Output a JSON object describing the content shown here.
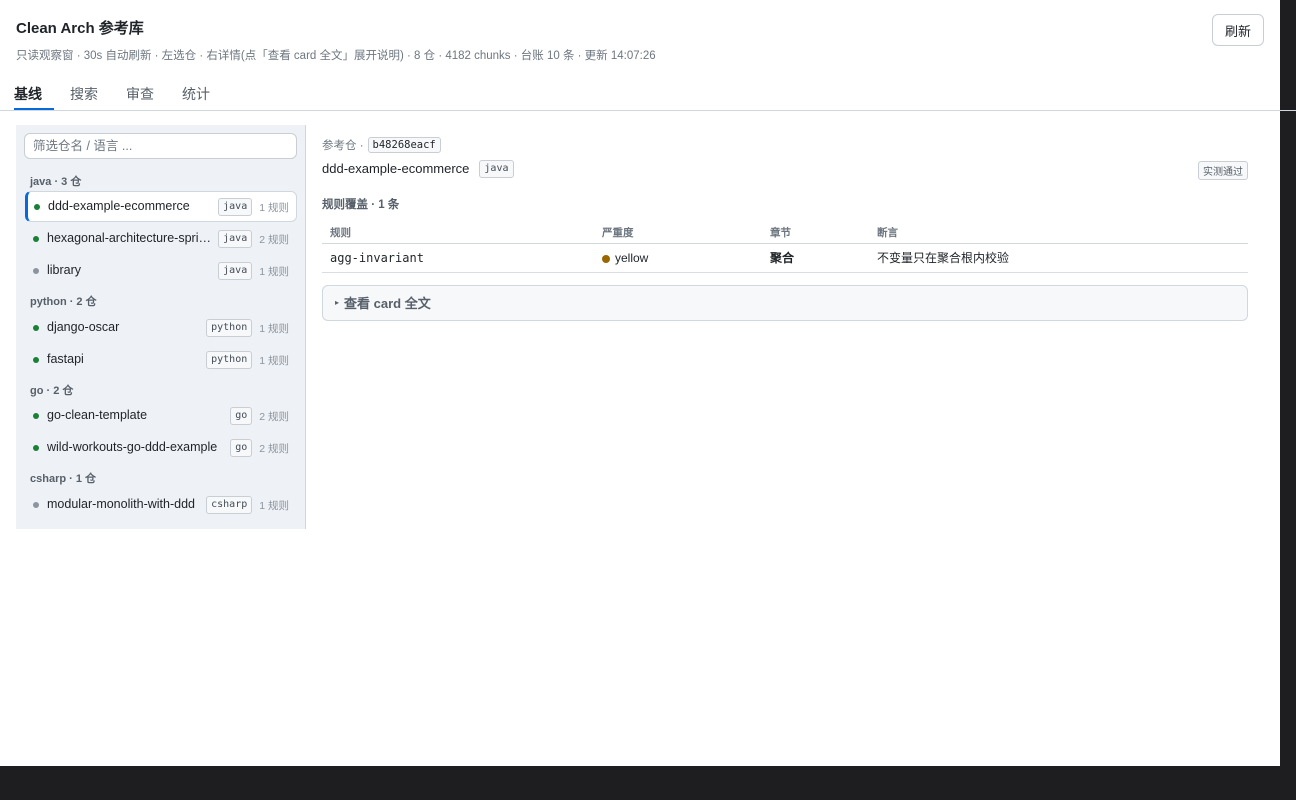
{
  "header": {
    "title": "Clean Arch 参考库",
    "subtitle": "只读观察窗 · 30s 自动刷新 · 左选仓 · 右详情(点「查看 card 全文」展开说明) · 8 仓 · 4182 chunks · 台账 10 条 · 更新 14:07:26",
    "refresh_label": "刷新"
  },
  "tabs": [
    {
      "label": "基线",
      "active": true
    },
    {
      "label": "搜索",
      "active": false
    },
    {
      "label": "审查",
      "active": false
    },
    {
      "label": "统计",
      "active": false
    }
  ],
  "sidebar": {
    "filter_placeholder": "筛选仓名 / 语言 ...",
    "groups": [
      {
        "label": "java · 3 仓",
        "repos": [
          {
            "name": "ddd-example-ecommerce",
            "lang": "java",
            "rules": "1 规则",
            "status": "green",
            "selected": true
          },
          {
            "name": "hexagonal-architecture-spring-boot",
            "lang": "java",
            "rules": "2 规则",
            "status": "green",
            "selected": false
          },
          {
            "name": "library",
            "lang": "java",
            "rules": "1 规则",
            "status": "gray",
            "selected": false
          }
        ]
      },
      {
        "label": "python · 2 仓",
        "repos": [
          {
            "name": "django-oscar",
            "lang": "python",
            "rules": "1 规则",
            "status": "green",
            "selected": false
          },
          {
            "name": "fastapi",
            "lang": "python",
            "rules": "1 规则",
            "status": "green",
            "selected": false
          }
        ]
      },
      {
        "label": "go · 2 仓",
        "repos": [
          {
            "name": "go-clean-template",
            "lang": "go",
            "rules": "2 规则",
            "status": "green",
            "selected": false
          },
          {
            "name": "wild-workouts-go-ddd-example",
            "lang": "go",
            "rules": "2 规则",
            "status": "green",
            "selected": false
          }
        ]
      },
      {
        "label": "csharp · 1 仓",
        "repos": [
          {
            "name": "modular-monolith-with-ddd",
            "lang": "csharp",
            "rules": "1 规则",
            "status": "gray",
            "selected": false
          }
        ]
      }
    ]
  },
  "detail": {
    "ref_label": "参考仓 ·",
    "commit": "b48268eacf",
    "repo_name": "ddd-example-ecommerce",
    "lang": "java",
    "status_badge": "实测通过",
    "coverage_title": "规则覆盖 · 1 条",
    "columns": {
      "rule": "规则",
      "severity": "严重度",
      "chapter": "章节",
      "assertion": "断言"
    },
    "rules": [
      {
        "rule": "agg-invariant",
        "severity": "yellow",
        "chapter": "聚合",
        "assertion": "不变量只在聚合根内校验"
      }
    ],
    "card_toggle": "查看 card 全文"
  },
  "colors": {
    "accent": "#0969da",
    "status_green": "#1a7f37",
    "status_gray": "#8c959f",
    "severity_yellow": "#9a6700"
  }
}
